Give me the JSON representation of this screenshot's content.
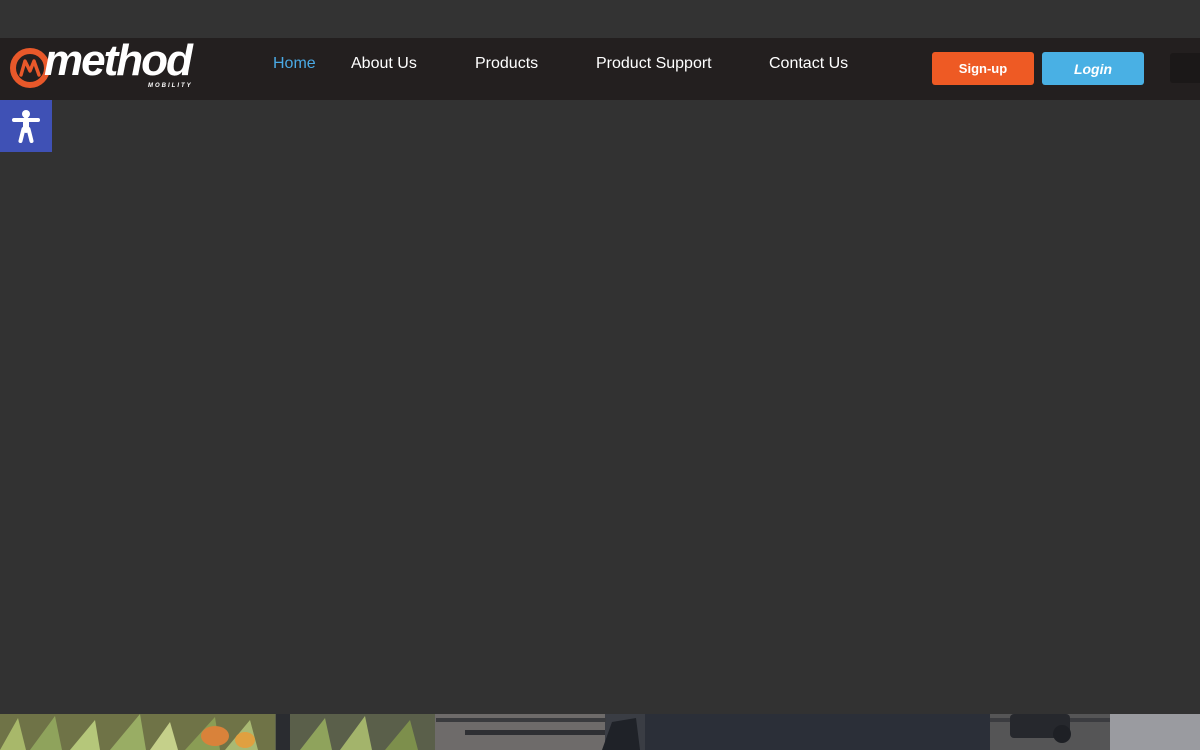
{
  "brand": {
    "logo_text": "method",
    "logo_subtext": "MOBILITY",
    "logo_color": "#e8582a"
  },
  "nav": {
    "items": [
      {
        "label": "Home",
        "active": true
      },
      {
        "label": "About Us",
        "active": false
      },
      {
        "label": "Products",
        "active": false
      },
      {
        "label": "Product Support",
        "active": false
      },
      {
        "label": "Contact Us",
        "active": false
      }
    ],
    "active_color": "#4aa9e4"
  },
  "actions": {
    "signup_label": "Sign-up",
    "signup_color": "#ee5a24",
    "login_label": "Login",
    "login_color": "#49b0e4"
  },
  "accessibility": {
    "icon": "accessibility-person-icon",
    "color": "#3f51b5"
  },
  "hero": {
    "background_color": "#323232",
    "photo": "wheelchair-garden-photo"
  }
}
